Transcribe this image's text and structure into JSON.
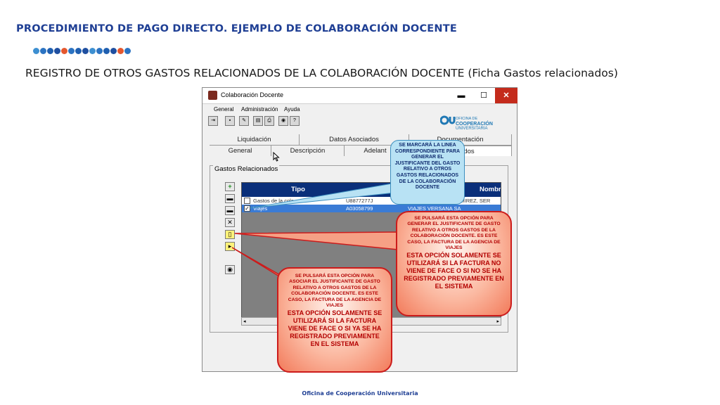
{
  "slide": {
    "title": "PROCEDIMIENTO DE PAGO DIRECTO. EJEMPLO DE COLABORACIÓN DOCENTE",
    "subtitle": "REGISTRO DE OTROS GASTOS RELACIONADOS DE LA COLABORACIÓN DOCENTE (Ficha Gastos relacionados)",
    "footer": "Oficina de Cooperación Universitaria",
    "dot_colors": [
      "#3d8fd1",
      "#2b73c2",
      "#1f5fb0",
      "#1f4fa0",
      "#e4572e",
      "#2b73c2",
      "#1f5fb0",
      "#1f4fa0",
      "#3d8fd1",
      "#2b73c2",
      "#1f5fb0",
      "#1f4fa0",
      "#e4572e",
      "#2b73c2"
    ]
  },
  "window": {
    "title": "Colaboración Docente",
    "controls": {
      "minimize": "▬",
      "maximize": "☐",
      "close": "✕"
    },
    "menu": [
      "General",
      "Administración",
      "Ayuda"
    ],
    "logo": {
      "line1": "OFICINA DE",
      "line2": "COOPERACIÓN",
      "line3": "UNIVERSITARIA"
    },
    "tabs_row1": [
      "Liquidación",
      "Datos Asociados",
      "Documentación"
    ],
    "tabs_row2": [
      "General",
      "Descripción",
      "Adelantos",
      "Gastos Relacionados"
    ],
    "tab2_visible": [
      "General",
      "Descripción",
      "Adelant",
      "acionados"
    ],
    "panel_label": "Gastos Relacionados",
    "grid": {
      "headers": [
        "Tipo",
        "Nombr"
      ],
      "rows": [
        {
          "tipo": "Gastos de la cola",
          "doc": "U8877277J",
          "nombre": "RAMIREZ, SER",
          "checked": false
        },
        {
          "tipo": "Viajes",
          "doc": "A03058799",
          "nombre": "VIAJES VERSANA SA",
          "checked": true
        }
      ]
    }
  },
  "callouts": {
    "blue": "SE MARCARÁ LA LINEA CORRESPONDIENTE PARA GENERAR EL JUSTIFICANTE DEL GASTO RELATIVO A OTROS GASTOS RELACIONADOS DE LA COLABORACIÓN DOCENTE",
    "right_small": "SE PULSARÁ ESTA OPCIÓN PARA GENERAR EL JUSTIFICANTE DE GASTO RELATIVO A OTROS GASTOS DE LA COLABORACIÓN DOCENTE. ES ESTE CASO, LA FACTURA DE LA AGENCIA DE VIAJES",
    "right_big": "ESTA OPCIÓN SOLAMENTE SE UTILIZARÁ SI LA FACTURA NO VIENE DE FACE O SI NO SE HA REGISTRADO PREVIAMENTE EN EL SISTEMA",
    "left_small": "SE PULSARÁ ESTA OPCIÓN PARA ASOCIAR EL JUSTIFICANTE DE GASTO RELATIVO A OTROS GASTOS DE LA COLABORACIÓN DOCENTE. ES ESTE CASO, LA FACTURA DE LA AGENCIA DE VIAJES",
    "left_big": "ESTA OPCIÓN SOLAMENTE SE UTILIZARÁ SI LA FACTURA VIENE DE FACE O SI YA SE HA REGISTRADO PREVIAMENTE EN EL SISTEMA"
  }
}
